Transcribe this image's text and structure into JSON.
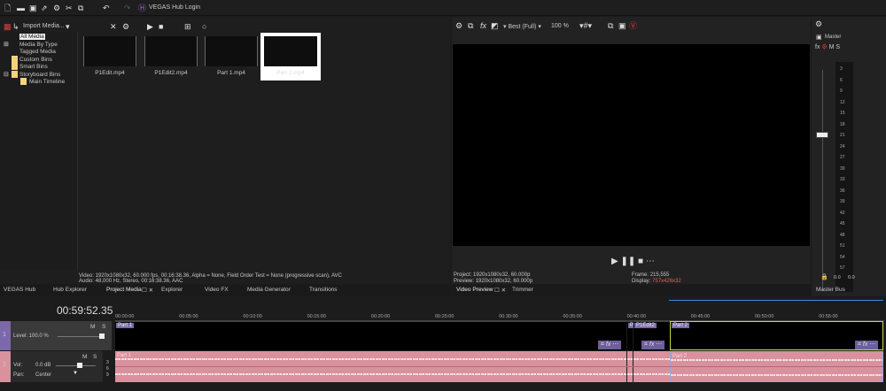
{
  "topbar": {
    "hub_label": "VEGAS Hub Login"
  },
  "explorer": {
    "import_label": "Import Media...",
    "tree": [
      "All Media",
      "Media By Type",
      "Tagged Media",
      "Custom Bins",
      "Smart Bins",
      "Storyboard Bins",
      "Main Timeline"
    ],
    "media": [
      "P1Edit.mp4",
      "P1Edit2.mp4",
      "Part 1.mp4",
      "Part 2.mp4"
    ],
    "info_video": "Video: 1920x1080x32, 60.000 fps, 00:16:38.36, Alpha = None, Field Order Test = None (progressive scan), AVC",
    "info_audio": "Audio: 48,000 Hz, Stereo, 00:16:38.36, AAC"
  },
  "left_tabs": [
    "VEGAS Hub",
    "Hub Explorer",
    "Project Media",
    "Explorer",
    "Video FX",
    "Media Generator",
    "Transitions"
  ],
  "preview": {
    "quality": "Best (Full)",
    "zoom": "100 %",
    "project_label": "Project:",
    "project_value": "1920x1080x32, 60.000p",
    "preview_label": "Preview:",
    "preview_value": "1920x1080x32, 60.000p",
    "frame_label": "Frame:",
    "frame_value": "215,555",
    "display_label": "Display:",
    "display_value": "757x426x32",
    "tabs": [
      "Video Preview",
      "Trimmer"
    ]
  },
  "master": {
    "title": "Master",
    "m": "M",
    "s": "S",
    "scale": [
      "3",
      "6",
      "9",
      "12",
      "15",
      "18",
      "21",
      "24",
      "27",
      "30",
      "33",
      "36",
      "39",
      "42",
      "45",
      "48",
      "51",
      "54",
      "57"
    ],
    "left_peak": "0.0",
    "right_peak": "0.0",
    "tab": "Master Bus"
  },
  "timeline": {
    "timecode": "00:59:52.35",
    "ruler": [
      "00:00:00",
      "00:05:00",
      "00:10:00",
      "00:15:00",
      "00:20:00",
      "00:25:00",
      "00:30:00",
      "00:35:00",
      "00:40:00",
      "00:45:00",
      "00:50:00",
      "00:55:00"
    ],
    "track1": {
      "num": "1",
      "level_label": "Level: 100.0 %",
      "m": "M",
      "s": "S"
    },
    "track2": {
      "num": "2",
      "vol_label": "Vol:",
      "vol_value": "0.0 dB",
      "pan_label": "Pan:",
      "pan_value": "Center",
      "m": "M",
      "s": "S",
      "scale": [
        "3",
        "6",
        "9"
      ]
    },
    "clips": [
      "Part 1",
      "P1",
      "P1Edit2",
      "Part 2"
    ],
    "fx_label": "fx"
  },
  "colors": {
    "video_track": "#7b69ab",
    "audio_track": "#d9919e",
    "selected": "#c8d64a",
    "display_value": "#e06060"
  }
}
